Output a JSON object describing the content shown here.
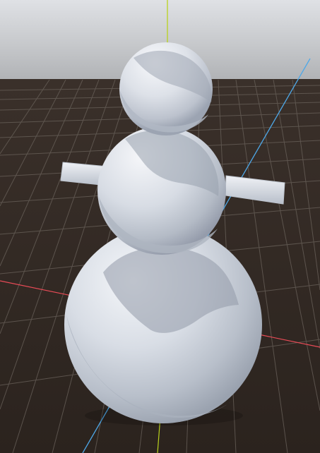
{
  "scene": {
    "kind": "3d-viewport",
    "object": "snowman",
    "colors": {
      "sky_top": "#dfe1e5",
      "sky_horizon": "#bdbfc2",
      "ground": "#2f2721",
      "grid_line": "#6a625b",
      "axis_x": "#e94b57",
      "axis_y": "#b9d21d",
      "axis_z": "#4ea8e8",
      "snow_light": "#f3f5f8",
      "snow_mid": "#b7bdc8",
      "snow_shadow": "#8d94a3"
    }
  }
}
